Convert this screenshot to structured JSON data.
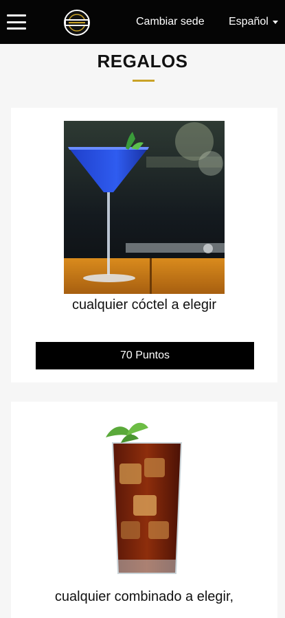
{
  "header": {
    "menu_icon": "hamburger-menu-icon",
    "logo_icon": "brand-logo",
    "change_location": "Cambiar sede",
    "language": "Español",
    "language_icon": "caret-down-icon"
  },
  "page": {
    "title": "REGALOS",
    "accent_color": "#c9a227"
  },
  "rewards": [
    {
      "title": "cualquier cóctel a elegir",
      "points_label": "70 Puntos",
      "image_icon": "blue-cocktail-image"
    },
    {
      "title": "cualquier combinado a elegir,",
      "image_icon": "cola-glass-image"
    }
  ]
}
